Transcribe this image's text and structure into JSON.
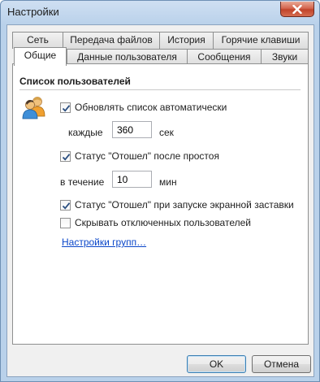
{
  "window": {
    "title": "Настройки"
  },
  "tabs": {
    "row1": [
      "Сеть",
      "Передача файлов",
      "История",
      "Горячие клавиши"
    ],
    "row2": [
      "Общие",
      "Данные пользователя",
      "Сообщения",
      "Звуки"
    ],
    "active": "Общие"
  },
  "group": {
    "title": "Список пользователей"
  },
  "options": {
    "auto_update": {
      "label": "Обновлять список автоматически",
      "checked": true
    },
    "every_label": "каждые",
    "every_value": "360",
    "every_unit": "сек",
    "away_idle": {
      "label": "Статус \"Отошел\" после простоя",
      "checked": true
    },
    "during_label": "в течение",
    "during_value": "10",
    "during_unit": "мин",
    "away_screensaver": {
      "label": "Статус \"Отошел\" при запуске экранной заставки",
      "checked": true
    },
    "hide_offline": {
      "label": "Скрывать отключенных пользователей",
      "checked": false
    },
    "groups_link": "Настройки групп…"
  },
  "buttons": {
    "ok": "OK",
    "cancel": "Отмена"
  },
  "icons": {
    "close": "close-icon",
    "users": "users-icon",
    "check": "checkmark-icon"
  }
}
